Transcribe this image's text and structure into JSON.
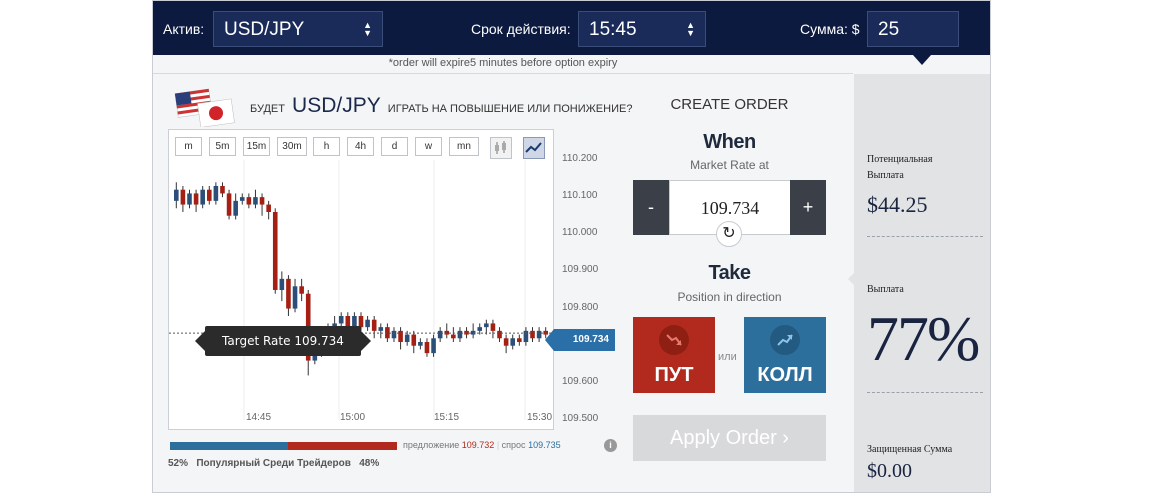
{
  "topbar": {
    "asset_label": "Актив:",
    "asset_value": "USD/JPY",
    "expiry_label": "Срок действия:",
    "expiry_value": "15:45",
    "amount_label": "Сумма: $",
    "amount_value": "25",
    "expiry_note": "*order will expire5 minutes before option expiry"
  },
  "headline": {
    "prefix": "БУДЕТ",
    "asset": "USD/JPY",
    "suffix": "ИГРАТЬ НА ПОВЫШЕНИЕ ИЛИ ПОНИЖЕНИЕ?"
  },
  "timeframes": [
    "m",
    "5m",
    "15m",
    "30m",
    "h",
    "4h",
    "d",
    "w",
    "mn"
  ],
  "chart_data": {
    "type": "candlestick",
    "y_ticks": [
      "110.200",
      "110.100",
      "110.000",
      "109.900",
      "109.800",
      "109.700",
      "109.600",
      "109.500"
    ],
    "x_ticks": [
      "14:45",
      "15:00",
      "15:15",
      "15:30"
    ],
    "ylim": [
      109.5,
      110.2
    ],
    "current_rate": "109.734",
    "target_rate_label": "Target Rate 109.734",
    "candles": [
      {
        "o": 110.09,
        "c": 110.12,
        "h": 110.14,
        "l": 110.07
      },
      {
        "o": 110.12,
        "c": 110.08,
        "h": 110.13,
        "l": 110.06
      },
      {
        "o": 110.08,
        "c": 110.11,
        "h": 110.12,
        "l": 110.07
      },
      {
        "o": 110.11,
        "c": 110.08,
        "h": 110.12,
        "l": 110.06
      },
      {
        "o": 110.08,
        "c": 110.12,
        "h": 110.13,
        "l": 110.07
      },
      {
        "o": 110.12,
        "c": 110.09,
        "h": 110.13,
        "l": 110.08
      },
      {
        "o": 110.09,
        "c": 110.13,
        "h": 110.14,
        "l": 110.08
      },
      {
        "o": 110.13,
        "c": 110.11,
        "h": 110.14,
        "l": 110.1
      },
      {
        "o": 110.11,
        "c": 110.05,
        "h": 110.12,
        "l": 110.04
      },
      {
        "o": 110.05,
        "c": 110.09,
        "h": 110.11,
        "l": 110.04
      },
      {
        "o": 110.09,
        "c": 110.1,
        "h": 110.11,
        "l": 110.08
      },
      {
        "o": 110.1,
        "c": 110.08,
        "h": 110.11,
        "l": 110.07
      },
      {
        "o": 110.08,
        "c": 110.1,
        "h": 110.12,
        "l": 110.07
      },
      {
        "o": 110.1,
        "c": 110.08,
        "h": 110.11,
        "l": 110.05
      },
      {
        "o": 110.08,
        "c": 110.06,
        "h": 110.09,
        "l": 110.04
      },
      {
        "o": 110.06,
        "c": 109.85,
        "h": 110.07,
        "l": 109.84
      },
      {
        "o": 109.85,
        "c": 109.88,
        "h": 109.9,
        "l": 109.82
      },
      {
        "o": 109.88,
        "c": 109.8,
        "h": 109.89,
        "l": 109.78
      },
      {
        "o": 109.8,
        "c": 109.86,
        "h": 109.88,
        "l": 109.79
      },
      {
        "o": 109.86,
        "c": 109.84,
        "h": 109.88,
        "l": 109.82
      },
      {
        "o": 109.84,
        "c": 109.66,
        "h": 109.85,
        "l": 109.62
      },
      {
        "o": 109.66,
        "c": 109.69,
        "h": 109.72,
        "l": 109.65
      },
      {
        "o": 109.69,
        "c": 109.7,
        "h": 109.72,
        "l": 109.67
      },
      {
        "o": 109.7,
        "c": 109.74,
        "h": 109.76,
        "l": 109.69
      },
      {
        "o": 109.74,
        "c": 109.76,
        "h": 109.78,
        "l": 109.73
      },
      {
        "o": 109.76,
        "c": 109.78,
        "h": 109.79,
        "l": 109.75
      },
      {
        "o": 109.78,
        "c": 109.75,
        "h": 109.79,
        "l": 109.74
      },
      {
        "o": 109.75,
        "c": 109.78,
        "h": 109.79,
        "l": 109.74
      },
      {
        "o": 109.78,
        "c": 109.75,
        "h": 109.79,
        "l": 109.74
      },
      {
        "o": 109.75,
        "c": 109.77,
        "h": 109.78,
        "l": 109.74
      },
      {
        "o": 109.77,
        "c": 109.74,
        "h": 109.78,
        "l": 109.72
      },
      {
        "o": 109.74,
        "c": 109.75,
        "h": 109.76,
        "l": 109.72
      },
      {
        "o": 109.75,
        "c": 109.72,
        "h": 109.76,
        "l": 109.71
      },
      {
        "o": 109.72,
        "c": 109.74,
        "h": 109.75,
        "l": 109.71
      },
      {
        "o": 109.74,
        "c": 109.71,
        "h": 109.75,
        "l": 109.69
      },
      {
        "o": 109.71,
        "c": 109.73,
        "h": 109.74,
        "l": 109.7
      },
      {
        "o": 109.73,
        "c": 109.7,
        "h": 109.74,
        "l": 109.68
      },
      {
        "o": 109.7,
        "c": 109.71,
        "h": 109.72,
        "l": 109.69
      },
      {
        "o": 109.71,
        "c": 109.68,
        "h": 109.72,
        "l": 109.67
      },
      {
        "o": 109.68,
        "c": 109.72,
        "h": 109.73,
        "l": 109.67
      },
      {
        "o": 109.72,
        "c": 109.74,
        "h": 109.75,
        "l": 109.71
      },
      {
        "o": 109.74,
        "c": 109.73,
        "h": 109.76,
        "l": 109.72
      },
      {
        "o": 109.73,
        "c": 109.72,
        "h": 109.75,
        "l": 109.71
      },
      {
        "o": 109.72,
        "c": 109.74,
        "h": 109.75,
        "l": 109.71
      },
      {
        "o": 109.74,
        "c": 109.73,
        "h": 109.75,
        "l": 109.72
      },
      {
        "o": 109.73,
        "c": 109.74,
        "h": 109.76,
        "l": 109.72
      },
      {
        "o": 109.74,
        "c": 109.75,
        "h": 109.76,
        "l": 109.73
      },
      {
        "o": 109.75,
        "c": 109.76,
        "h": 109.77,
        "l": 109.73
      },
      {
        "o": 109.76,
        "c": 109.74,
        "h": 109.77,
        "l": 109.72
      },
      {
        "o": 109.74,
        "c": 109.72,
        "h": 109.75,
        "l": 109.71
      },
      {
        "o": 109.72,
        "c": 109.7,
        "h": 109.73,
        "l": 109.68
      },
      {
        "o": 109.7,
        "c": 109.72,
        "h": 109.73,
        "l": 109.69
      },
      {
        "o": 109.72,
        "c": 109.71,
        "h": 109.73,
        "l": 109.7
      },
      {
        "o": 109.71,
        "c": 109.74,
        "h": 109.75,
        "l": 109.7
      },
      {
        "o": 109.74,
        "c": 109.72,
        "h": 109.75,
        "l": 109.71
      },
      {
        "o": 109.72,
        "c": 109.74,
        "h": 109.75,
        "l": 109.71
      },
      {
        "o": 109.74,
        "c": 109.73,
        "h": 109.75,
        "l": 109.72
      }
    ]
  },
  "sentiment": {
    "put_pct": 48,
    "call_pct": 52,
    "text": "52%   Популярный Среди Трейдеров   48%",
    "bid_label": "предложение",
    "bid_value": "109.732",
    "ask_label": "спрос",
    "ask_value": "109.735",
    "info": "i"
  },
  "order": {
    "title": "CREATE ORDER",
    "when_title": "When",
    "when_sub": "Market Rate at",
    "rate_value": "109.734",
    "minus": "-",
    "plus": "+",
    "take_title": "Take",
    "take_sub": "Position in direction",
    "put_label": "ПУТ",
    "call_label": "КОЛЛ",
    "or_text": "или",
    "apply_label": "Apply Order ›"
  },
  "payout": {
    "potential_label": "Потенциальная Выплата",
    "potential_value": "$44.25",
    "payout_label": "Выплата",
    "payout_value": "77%",
    "protected_label": "Защищенная Сумма",
    "protected_value": "$0.00"
  },
  "colors": {
    "navy": "#0c1a3f",
    "put_red": "#b22a1d",
    "call_blue": "#2c6e9c",
    "candle_up": "#2c4f7a",
    "candle_down": "#a51f12"
  }
}
